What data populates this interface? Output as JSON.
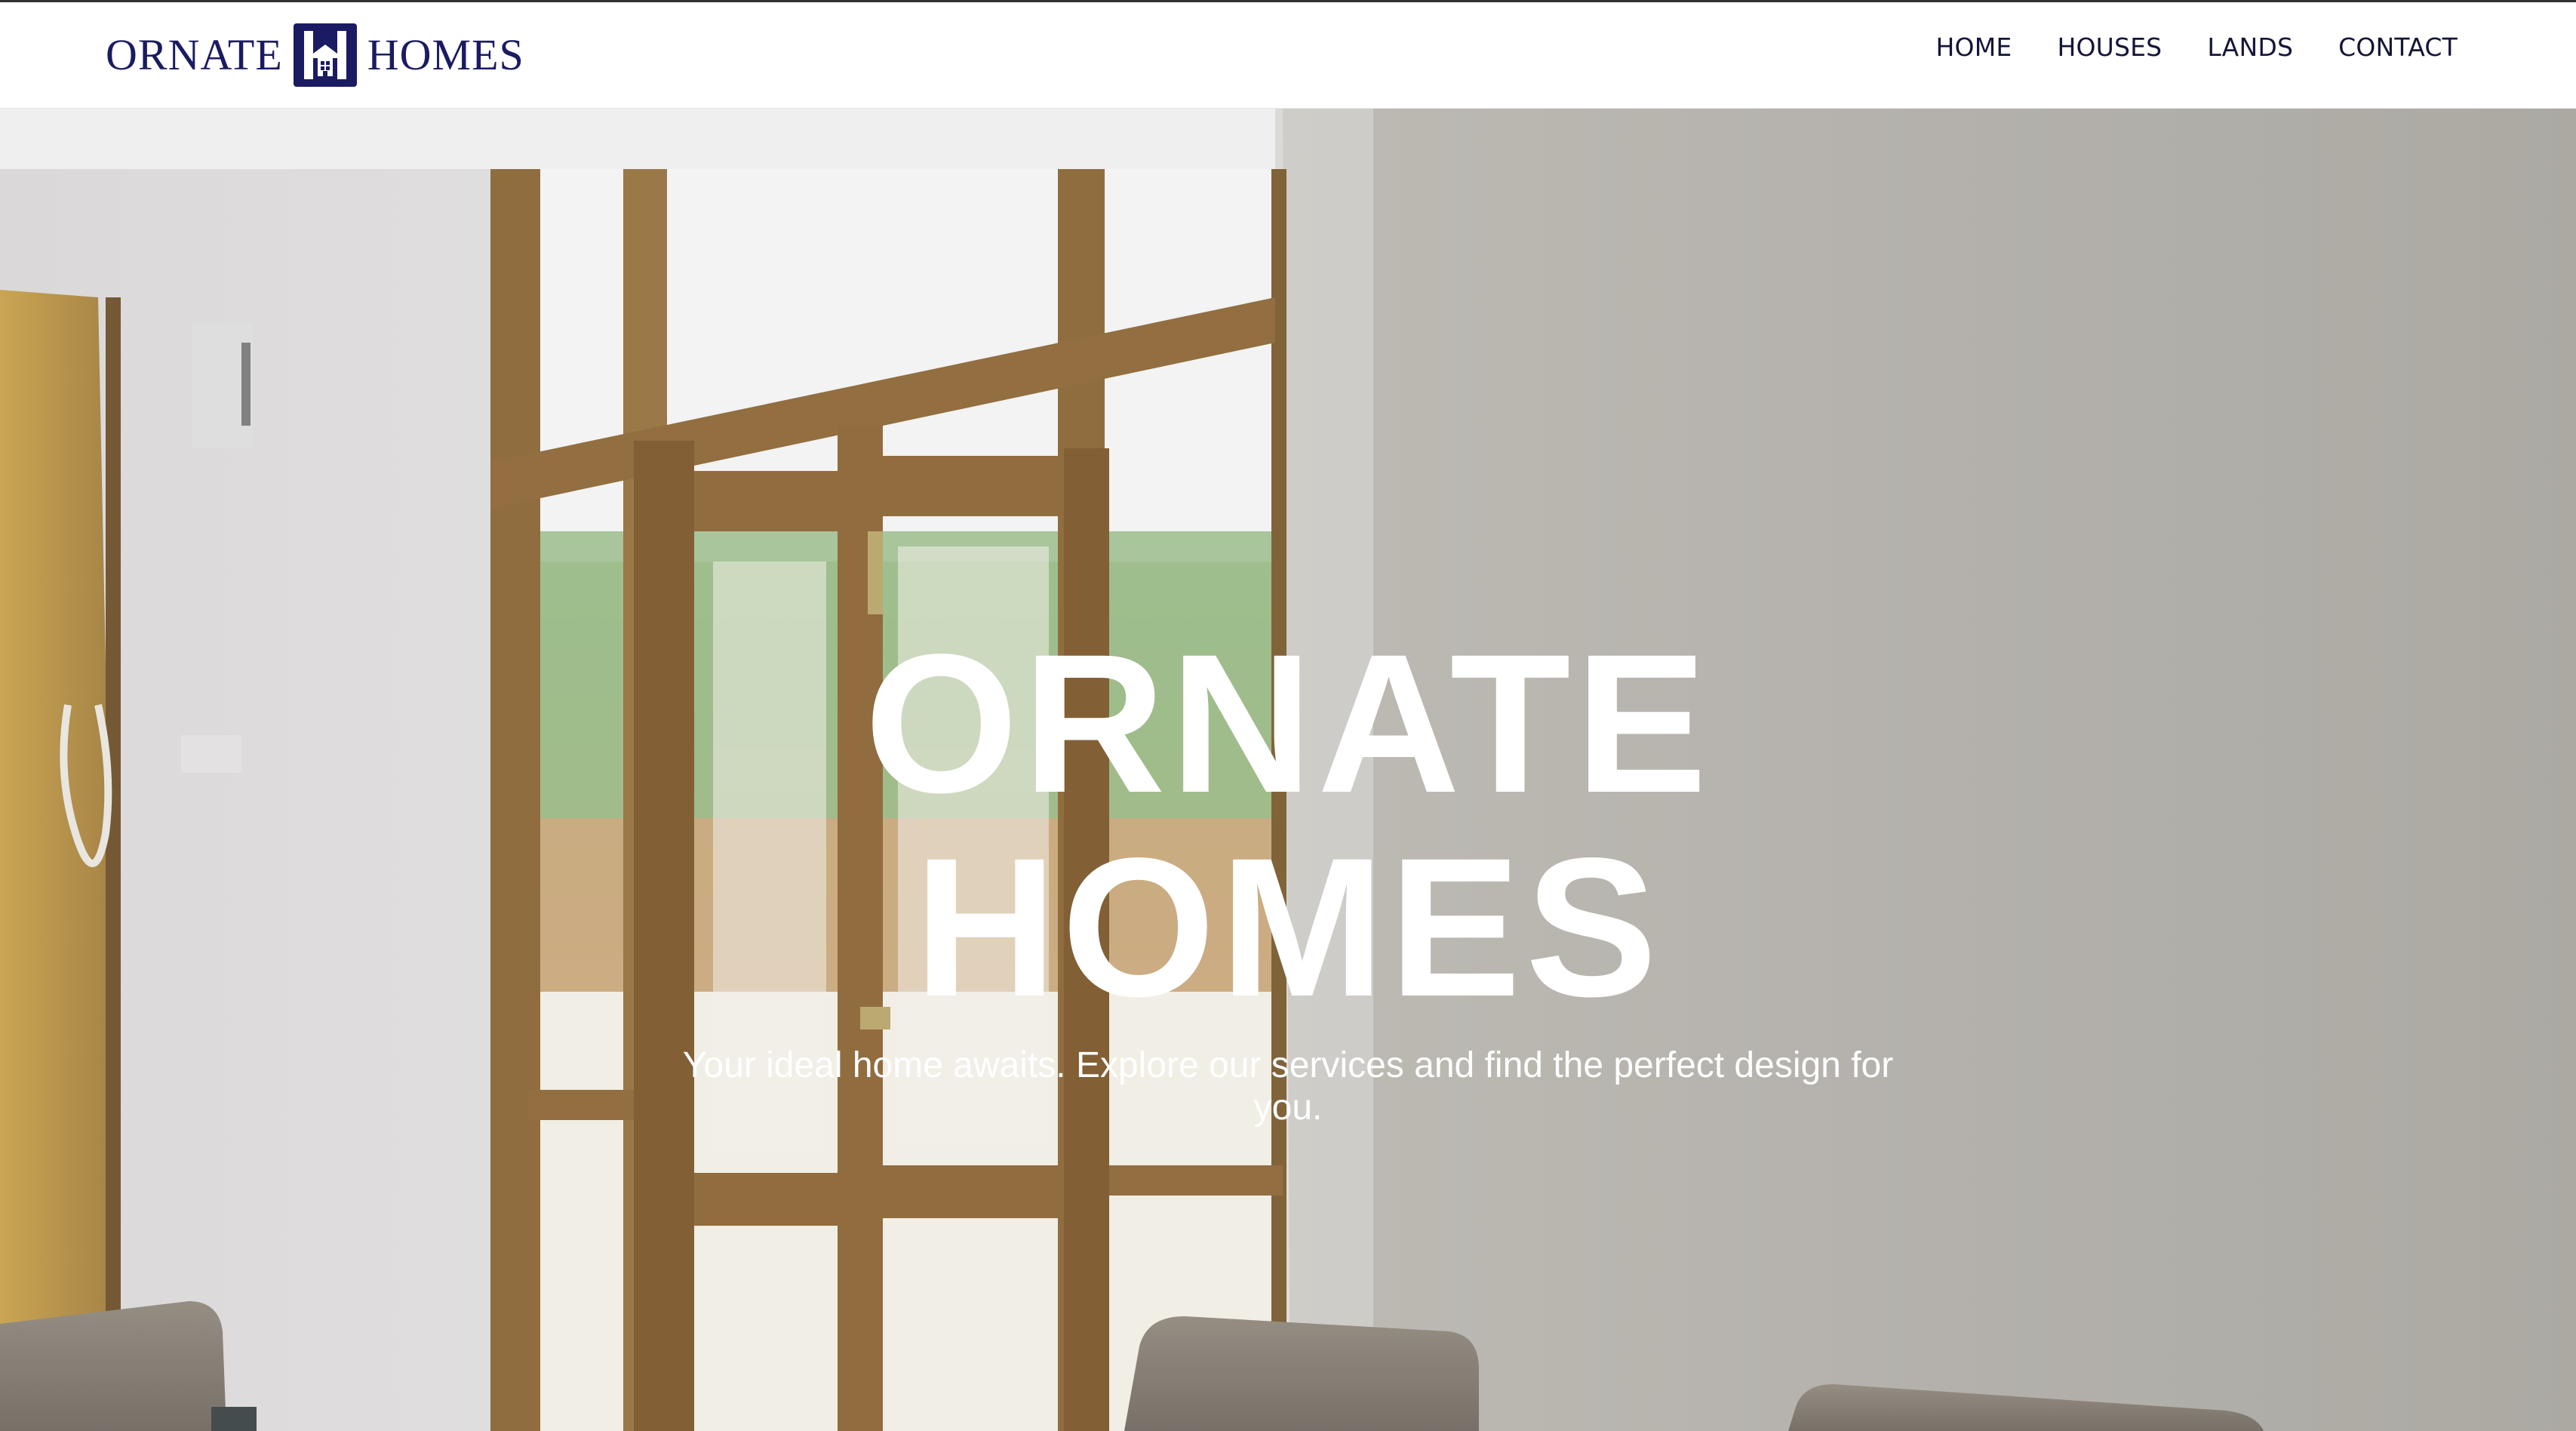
{
  "brand": {
    "name_left": "ORNATE",
    "name_right": "HOMES",
    "mark_letter": "H",
    "color": "#1b1b63"
  },
  "nav": {
    "items": [
      {
        "label": "HOME"
      },
      {
        "label": "HOUSES"
      },
      {
        "label": "LANDS"
      },
      {
        "label": "CONTACT"
      }
    ]
  },
  "hero": {
    "title_line1": "ORNATE",
    "title_line2": "HOMES",
    "subtitle": "Your ideal home awaits. Explore our services and find the perfect design for you.",
    "background_image": "interior-with-wooden-glass-doors-and-chairs"
  }
}
